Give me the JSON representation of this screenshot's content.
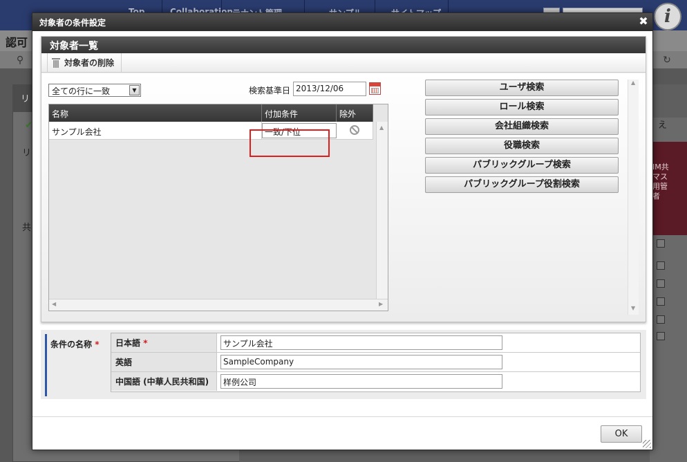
{
  "background": {
    "nav_items": [
      "Top",
      "Collaboration",
      "テナント管理",
      "サンプル",
      "サイトマップ"
    ],
    "page_title": "認可",
    "panel_texts": [
      "リ",
      "リ",
      "共"
    ],
    "promo_text": "IM共\nマス\n用管\n者",
    "right_header": "え",
    "logo_letter": "i"
  },
  "dialog": {
    "title": "対象者の条件設定",
    "close_glyph": "✖",
    "section_title": "対象者一覧",
    "toolbar": {
      "delete_label": "対象者の削除"
    },
    "match_select": {
      "selected": "全ての行に一致",
      "arrow": "▼"
    },
    "date": {
      "label": "検索基準日",
      "value": "2013/12/06"
    },
    "grid": {
      "columns": [
        "名称",
        "付加条件",
        "除外"
      ],
      "rows": [
        {
          "name": "サンプル会社",
          "condition": "一致/下位"
        }
      ]
    },
    "search_buttons": [
      "ユーザ検索",
      "ロール検索",
      "会社組織検索",
      "役職検索",
      "パブリックグループ検索",
      "パブリックグループ役割検索"
    ],
    "condition_name": {
      "label": "条件の名称",
      "required_mark": "*",
      "rows": [
        {
          "lang": "日本語",
          "required": "*",
          "value": "サンプル会社"
        },
        {
          "lang": "英語",
          "required": "",
          "value": "SampleCompany"
        },
        {
          "lang": "中国語 (中華人民共和国)",
          "required": "",
          "value": "样例公司"
        }
      ]
    },
    "ok_label": "OK"
  },
  "colors": {
    "dialog_header": "#2c2c2c",
    "highlight": "#e01c1c",
    "required": "#d21d1d",
    "label_accent": "#2e56a8"
  }
}
